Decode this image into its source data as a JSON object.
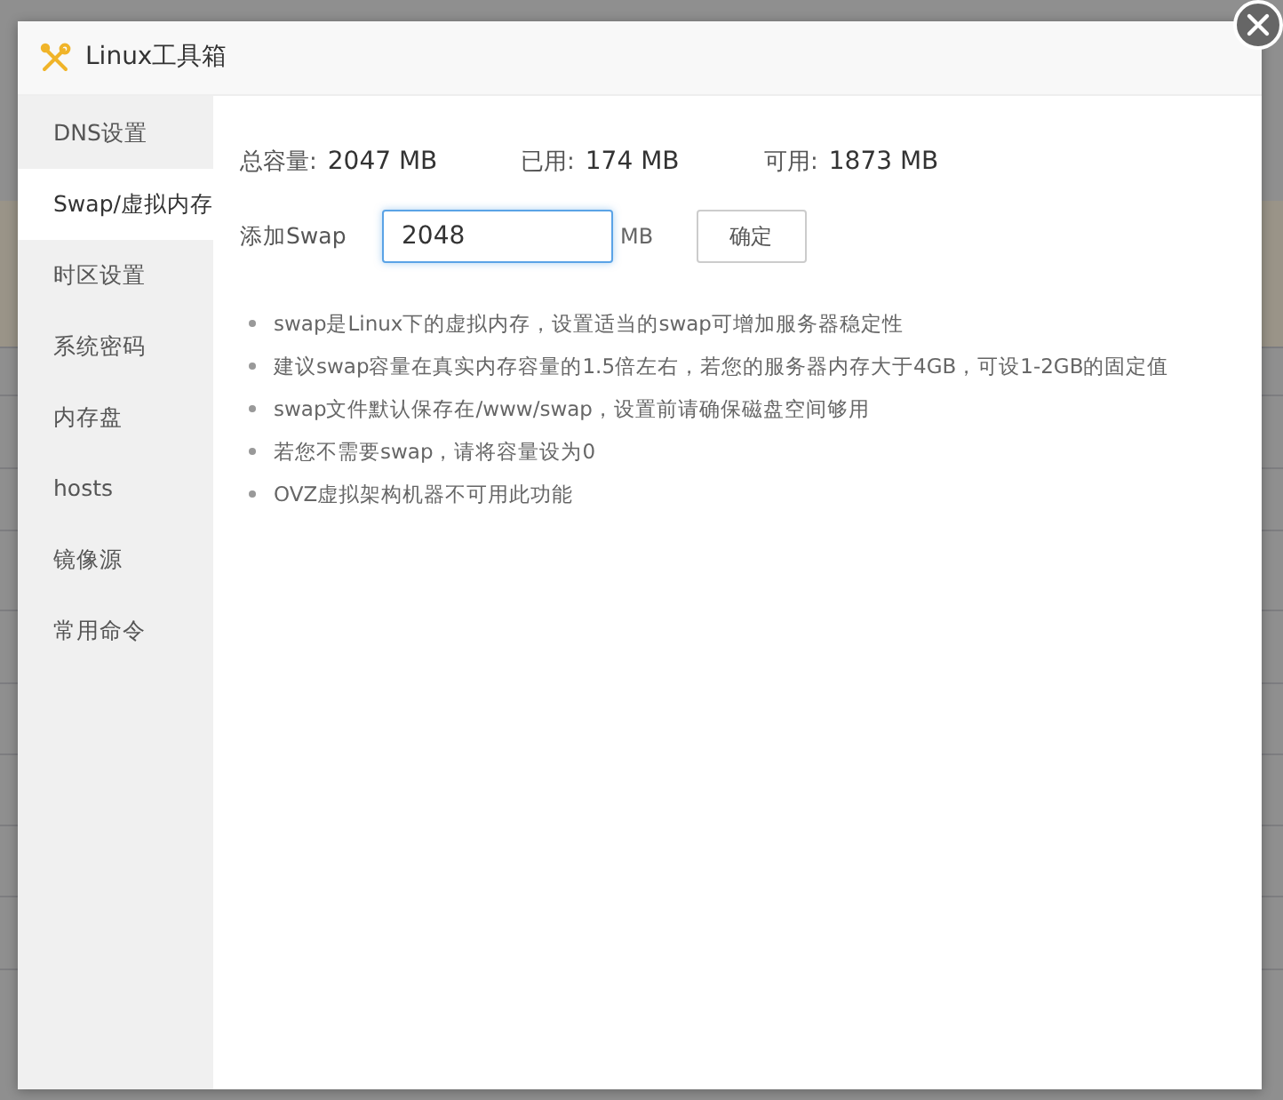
{
  "dialog": {
    "title": "Linux工具箱"
  },
  "sidebar": {
    "items": [
      {
        "label": "DNS设置",
        "selected": false
      },
      {
        "label": "Swap/虚拟内存",
        "selected": true
      },
      {
        "label": "时区设置",
        "selected": false
      },
      {
        "label": "系统密码",
        "selected": false
      },
      {
        "label": "内存盘",
        "selected": false
      },
      {
        "label": "hosts",
        "selected": false
      },
      {
        "label": "镜像源",
        "selected": false
      },
      {
        "label": "常用命令",
        "selected": false
      }
    ]
  },
  "stats": [
    {
      "label": "总容量:",
      "value": "2047 MB"
    },
    {
      "label": "已用:",
      "value": "174 MB"
    },
    {
      "label": "可用:",
      "value": "1873 MB"
    }
  ],
  "form": {
    "label": "添加Swap",
    "value": "2048",
    "unit": "MB",
    "button": "确定"
  },
  "notes": [
    "swap是Linux下的虚拟内存，设置适当的swap可增加服务器稳定性",
    "建议swap容量在真实内存容量的1.5倍左右，若您的服务器内存大于4GB，可设1-2GB的固定值",
    "swap文件默认保存在/www/swap，设置前请确保磁盘空间够用",
    "若您不需要swap，请将容量设为0",
    "OVZ虚拟架构机器不可用此功能"
  ]
}
